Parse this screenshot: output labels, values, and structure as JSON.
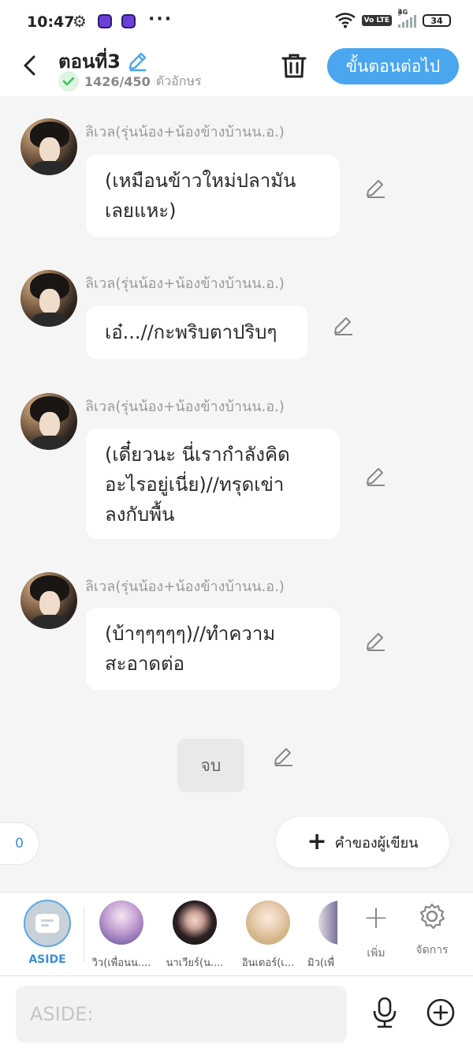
{
  "status_bar": {
    "time": "10:47",
    "network": "4G",
    "volte": "Vo LTE",
    "battery": "34"
  },
  "header": {
    "title": "ตอนที่3",
    "char_count": "1426/450",
    "char_unit": "ตัวอักษร",
    "next_button": "ขั้นตอนต่อไป"
  },
  "messages": [
    {
      "sender": "ลิเวล(รุ่นน้อง+น้องข้างบ้านน.อ.)",
      "lines": [
        "(เหมือนข้าวใหม่ปลามัน",
        "เลยแหะ)"
      ]
    },
    {
      "sender": "ลิเวล(รุ่นน้อง+น้องข้างบ้านน.อ.)",
      "lines": [
        "เอ๋...//กะพริบตาปริบๆ"
      ]
    },
    {
      "sender": "ลิเวล(รุ่นน้อง+น้องข้างบ้านน.อ.)",
      "lines": [
        "(เดี๋ยวนะ นี่เรากำลังคิด",
        "อะไรอยู่เนี่ย)//ทรุดเข่า",
        "ลงกับพื้น"
      ]
    },
    {
      "sender": "ลิเวล(รุ่นน้อง+น้องข้างบ้านน.อ.)",
      "lines": [
        "(บ้าๆๆๆๆๆ)//ทำความ",
        "สะอาดต่อ"
      ]
    }
  ],
  "end_marker": "จบ",
  "counter": "0",
  "author_note_button": "คำของผู้เขียน",
  "character_bar": {
    "aside_label": "ASIDE",
    "characters": [
      {
        "name": "วิว(เพื่อนน...."
      },
      {
        "name": "นาเวียร์(น...."
      },
      {
        "name": "อินเดอร์(เ..."
      },
      {
        "name": "มิว(เพื่"
      }
    ],
    "add_label": "เพิ่ม",
    "manage_label": "จัดการ"
  },
  "input": {
    "placeholder": "ASIDE:"
  },
  "colors": {
    "accent": "#4aa6ee",
    "background": "#f5f5f5",
    "bubble": "#ffffff"
  }
}
